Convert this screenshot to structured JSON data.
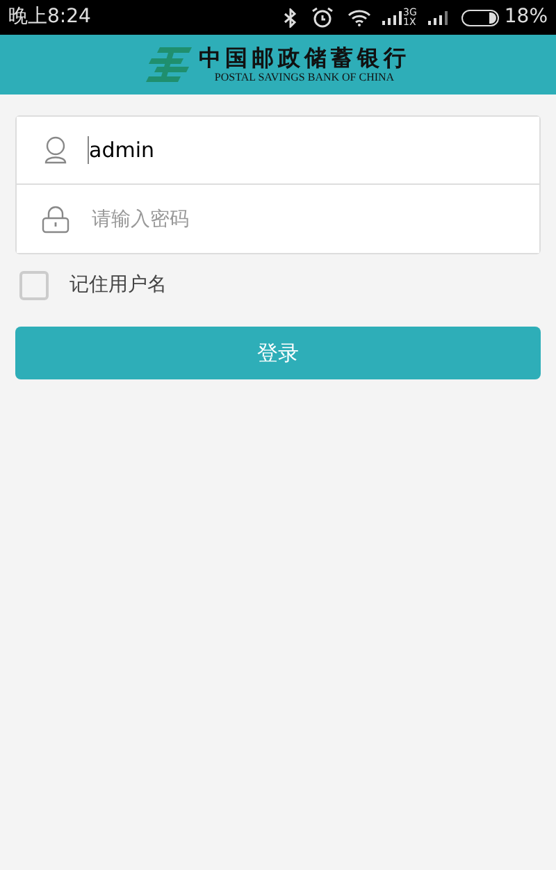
{
  "status_bar": {
    "time": "晚上8:24",
    "network_top": "3G",
    "network_bottom": "1X",
    "battery": "18%"
  },
  "header": {
    "bank_name": "中国邮政储蓄银行",
    "bank_name_en": "POSTAL SAVINGS BANK OF CHINA"
  },
  "username_field": {
    "value": "admin"
  },
  "password_field": {
    "placeholder": "请输入密码"
  },
  "remember": {
    "label": "记住用户名",
    "checked": false
  },
  "login_button": {
    "label": "登录"
  }
}
